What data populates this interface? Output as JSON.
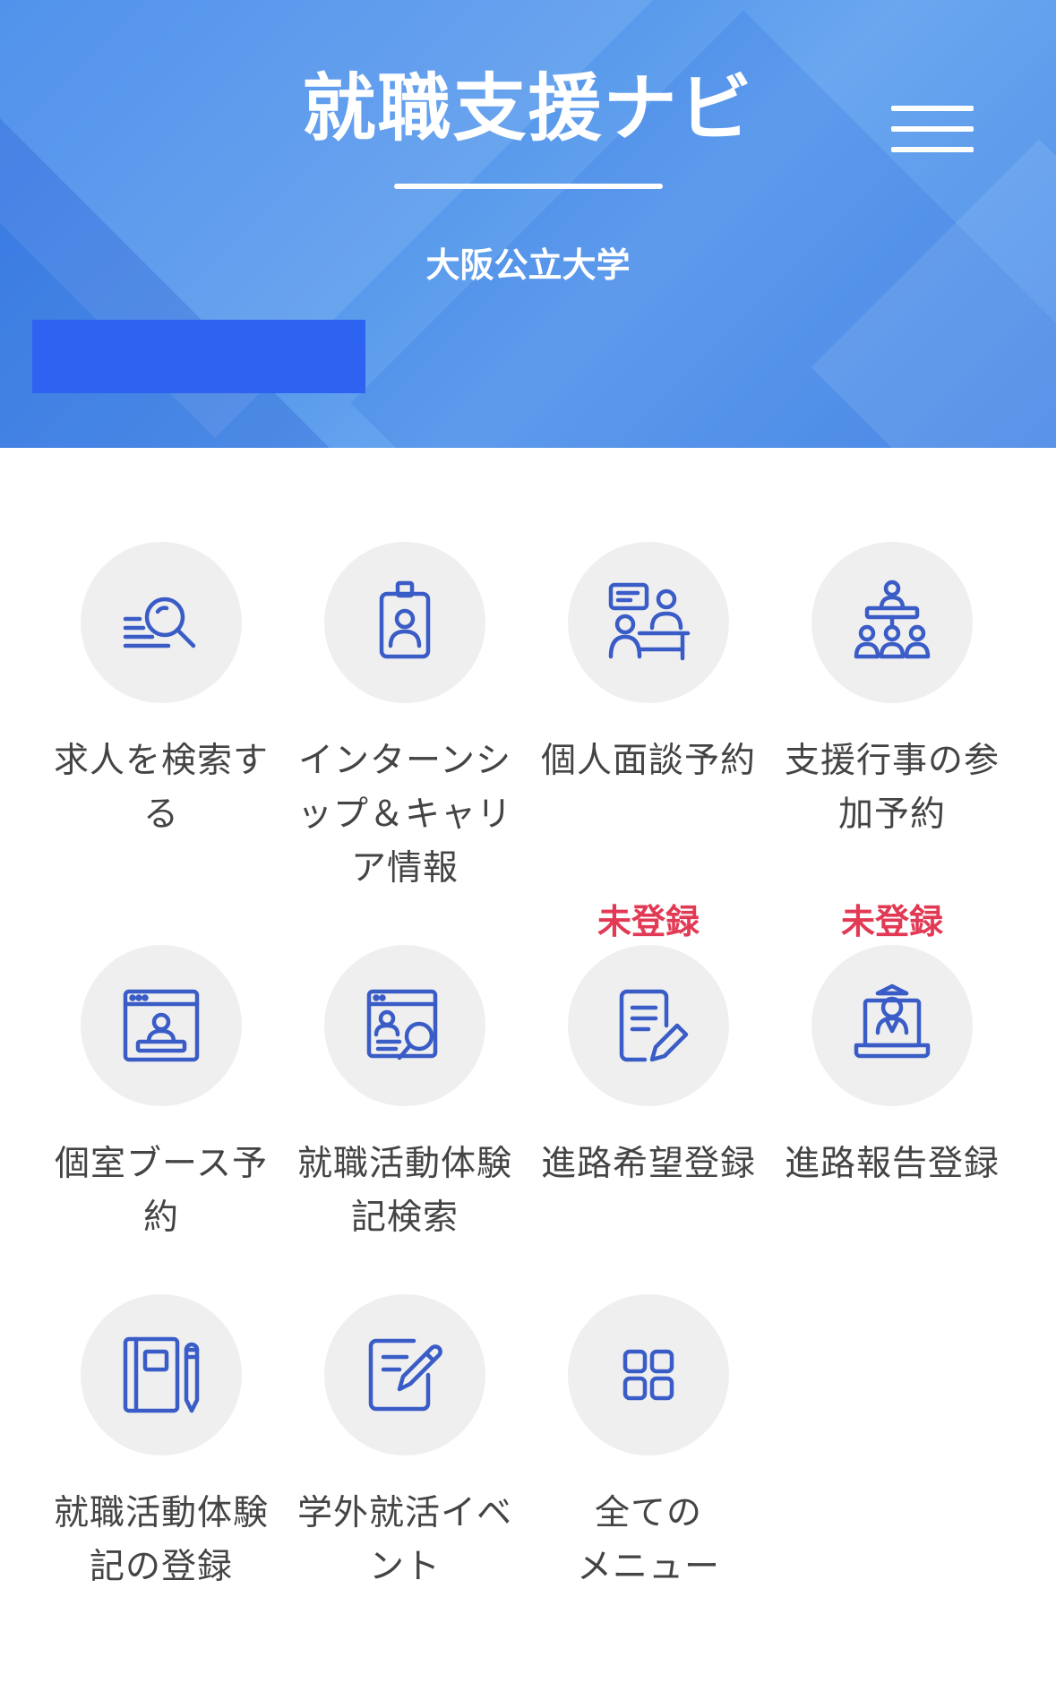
{
  "header": {
    "title": "就職支援ナビ",
    "university": "大阪公立大学"
  },
  "colors": {
    "accent": "#3a5cc6",
    "badge": "#e23a55",
    "circle_bg": "#efeff0",
    "label_text": "#444444"
  },
  "menu": [
    {
      "label": "求人を検索す\nる",
      "icon": "search-list-icon",
      "badge": ""
    },
    {
      "label": "インターンシ\nップ＆キャリ\nア情報",
      "icon": "id-badge-icon",
      "badge": ""
    },
    {
      "label": "個人面談予約",
      "icon": "consultation-icon",
      "badge": ""
    },
    {
      "label": "支援行事の参\n加予約",
      "icon": "seminar-icon",
      "badge": ""
    },
    {
      "label": "個室ブース予\n約",
      "icon": "booth-window-icon",
      "badge": ""
    },
    {
      "label": "就職活動体験\n記検索",
      "icon": "profile-search-icon",
      "badge": ""
    },
    {
      "label": "進路希望登録",
      "icon": "document-edit-icon",
      "badge": "未登録"
    },
    {
      "label": "進路報告登録",
      "icon": "graduate-laptop-icon",
      "badge": "未登録"
    },
    {
      "label": "就職活動体験\n記の登録",
      "icon": "notebook-pen-icon",
      "badge": ""
    },
    {
      "label": "学外就活イベ\nント",
      "icon": "note-pencil-icon",
      "badge": ""
    },
    {
      "label": "全ての\nメニュー",
      "icon": "grid-menu-icon",
      "badge": ""
    }
  ]
}
